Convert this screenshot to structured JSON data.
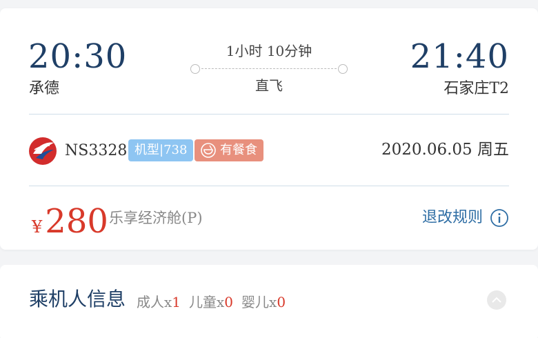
{
  "flight": {
    "departure_time": "20:30",
    "departure_city": "承德",
    "arrival_time": "21:40",
    "arrival_city": "石家庄T2",
    "duration": "1小时 10分钟",
    "stop_type": "直飞",
    "flight_number": "NS3328",
    "aircraft_type": "机型|738",
    "meal": "有餐食",
    "date": "2020.06.05 周五",
    "airline_logo_icon": "airline-bird-logo"
  },
  "fare": {
    "currency": "¥",
    "price": "280",
    "cabin": "乐享经济舱(P)",
    "rules_label": "退改规则"
  },
  "passengers": {
    "title": "乘机人信息",
    "adult_label": "成人x",
    "adult_count": "1",
    "child_label": "儿童x",
    "child_count": "0",
    "infant_label": "婴儿x",
    "infant_count": "0"
  },
  "colors": {
    "accent_blue": "#1f3f66",
    "link_blue": "#2e6da4",
    "price_red": "#d8392a",
    "badge_blue": "#8ec5f2",
    "badge_salmon": "#e8907d"
  }
}
